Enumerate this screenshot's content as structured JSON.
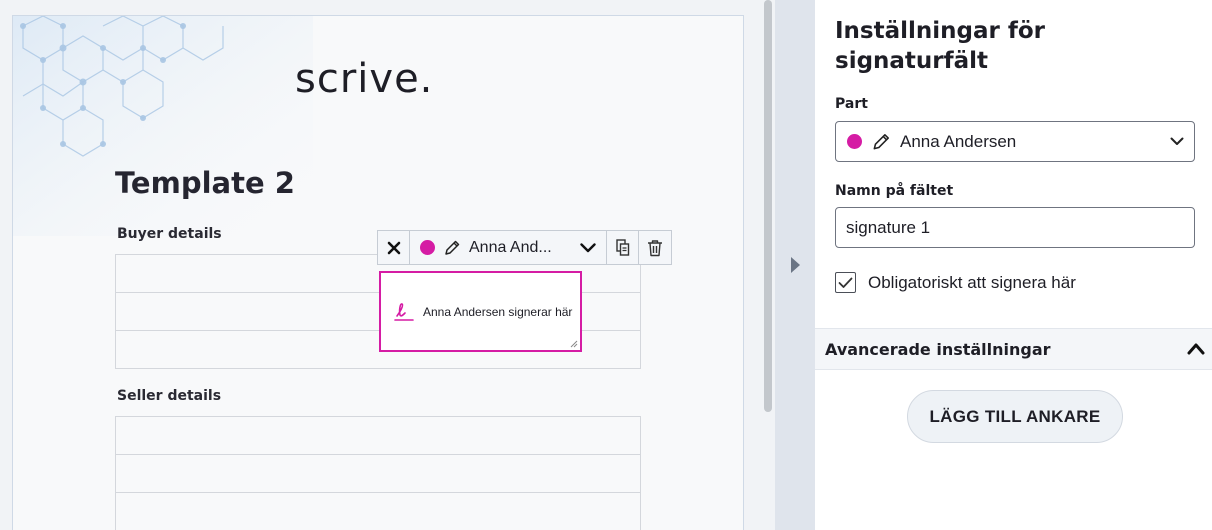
{
  "document": {
    "logo_text": "scrive.",
    "title": "Template 2",
    "sections": [
      {
        "label": "Buyer details",
        "rows": 3
      },
      {
        "label": "Seller details",
        "rows": 3
      }
    ]
  },
  "field_toolbar": {
    "party_name": "Anna And...",
    "party_color": "#d51ca4",
    "icons": [
      "close-icon",
      "pen-icon",
      "chevron-down-icon",
      "copy-icon",
      "trash-icon"
    ]
  },
  "signature_field": {
    "placeholder_text": "Anna Andersen signerar här",
    "border_color": "#d51ca4"
  },
  "settings_panel": {
    "title": "Inställningar för signaturfält",
    "party_label": "Part",
    "party_value": "Anna Andersen",
    "field_name_label": "Namn på fältet",
    "field_name_value": "signature 1",
    "required_label": "Obligatoriskt att signera här",
    "required_checked": true,
    "advanced_label": "Avancerade inställningar",
    "add_anchor_label": "LÄGG TILL ANKARE"
  }
}
